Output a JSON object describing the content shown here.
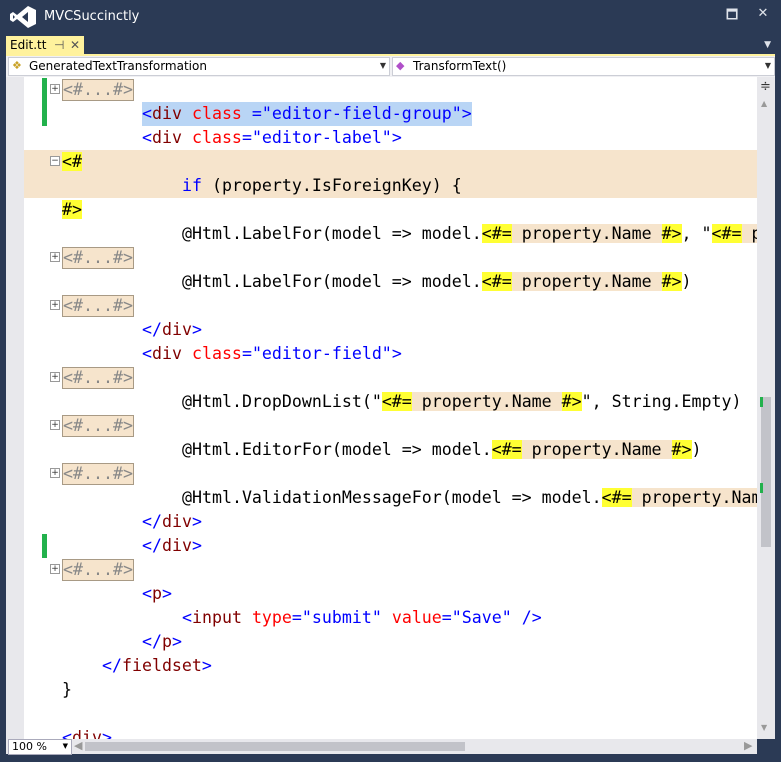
{
  "window": {
    "title": "MVCSuccinctly",
    "maximize_icon": "maximize-icon",
    "close_icon": "close-icon"
  },
  "tab": {
    "label": "Edit.tt",
    "pin_glyph": "⊣",
    "close_glyph": "✕"
  },
  "navbar": {
    "type_combo": "GeneratedTextTransformation",
    "member_combo": "TransformText()"
  },
  "zoom": {
    "value": "100 %"
  },
  "colors": {
    "frame": "#2b3a55",
    "tab": "#fff29d",
    "t4_tag": "#ffff33",
    "t4_block": "#f6e4cc",
    "selection": "#b9d5f5",
    "change_marker": "#22b14c"
  },
  "lines": [
    {
      "indent": 0,
      "toggle": "+",
      "marker": true,
      "segs": [
        [
          "box",
          "<#...#>"
        ]
      ]
    },
    {
      "indent": 8,
      "marker": true,
      "sel": true,
      "segs": [
        [
          "d",
          "<"
        ],
        [
          "e",
          "div"
        ],
        [
          "a",
          " class"
        ],
        [
          "d",
          " ="
        ],
        [
          "v",
          "\"editor-field-group\""
        ],
        [
          "d",
          ">"
        ]
      ]
    },
    {
      "indent": 8,
      "segs": [
        [
          "d",
          "<"
        ],
        [
          "e",
          "div"
        ],
        [
          "a",
          " class"
        ],
        [
          "d",
          "="
        ],
        [
          "v",
          "\"editor-label\""
        ],
        [
          "d",
          ">"
        ]
      ]
    },
    {
      "indent": 0,
      "toggle": "−",
      "bg": "tan",
      "segs": [
        [
          "y",
          "<#"
        ]
      ]
    },
    {
      "indent": 12,
      "bg": "tan",
      "segs": [
        [
          "k",
          "if"
        ],
        [
          "t",
          " (property.IsForeignKey) {"
        ]
      ]
    },
    {
      "indent": 0,
      "segs": [
        [
          "y",
          "#>"
        ]
      ]
    },
    {
      "indent": 12,
      "segs": [
        [
          "t",
          "@Html.LabelFor(model => model."
        ],
        [
          "y",
          "<#="
        ],
        [
          "c",
          " property.Name "
        ],
        [
          "y",
          "#>"
        ],
        [
          "t",
          ", \""
        ],
        [
          "y",
          "<#="
        ],
        [
          "c",
          " property.Name "
        ],
        [
          "y",
          "#>"
        ]
      ]
    },
    {
      "indent": 0,
      "toggle": "+",
      "segs": [
        [
          "box",
          "<#...#>"
        ]
      ]
    },
    {
      "indent": 12,
      "segs": [
        [
          "t",
          "@Html.LabelFor(model => model."
        ],
        [
          "y",
          "<#="
        ],
        [
          "c",
          " property.Name "
        ],
        [
          "y",
          "#>"
        ],
        [
          "t",
          ")"
        ]
      ]
    },
    {
      "indent": 0,
      "toggle": "+",
      "segs": [
        [
          "box",
          "<#...#>"
        ]
      ]
    },
    {
      "indent": 8,
      "segs": [
        [
          "d",
          "</"
        ],
        [
          "e",
          "div"
        ],
        [
          "d",
          ">"
        ]
      ]
    },
    {
      "indent": 8,
      "segs": [
        [
          "d",
          "<"
        ],
        [
          "e",
          "div"
        ],
        [
          "a",
          " class"
        ],
        [
          "d",
          "="
        ],
        [
          "v",
          "\"editor-field\""
        ],
        [
          "d",
          ">"
        ]
      ]
    },
    {
      "indent": 0,
      "toggle": "+",
      "segs": [
        [
          "box",
          "<#...#>"
        ]
      ]
    },
    {
      "indent": 12,
      "segs": [
        [
          "t",
          "@Html.DropDownList(\""
        ],
        [
          "y",
          "<#="
        ],
        [
          "c",
          " property.Name "
        ],
        [
          "y",
          "#>"
        ],
        [
          "t",
          "\", String.Empty)"
        ]
      ]
    },
    {
      "indent": 0,
      "toggle": "+",
      "segs": [
        [
          "box",
          "<#...#>"
        ]
      ]
    },
    {
      "indent": 12,
      "segs": [
        [
          "t",
          "@Html.EditorFor(model => model."
        ],
        [
          "y",
          "<#="
        ],
        [
          "c",
          " property.Name "
        ],
        [
          "y",
          "#>"
        ],
        [
          "t",
          ")"
        ]
      ]
    },
    {
      "indent": 0,
      "toggle": "+",
      "segs": [
        [
          "box",
          "<#...#>"
        ]
      ]
    },
    {
      "indent": 12,
      "segs": [
        [
          "t",
          "@Html.ValidationMessageFor(model => model."
        ],
        [
          "y",
          "<#="
        ],
        [
          "c",
          " property.Name "
        ],
        [
          "y",
          "#>"
        ]
      ]
    },
    {
      "indent": 8,
      "segs": [
        [
          "d",
          "</"
        ],
        [
          "e",
          "div"
        ],
        [
          "d",
          ">"
        ]
      ]
    },
    {
      "indent": 8,
      "marker": true,
      "segs": [
        [
          "d",
          "</"
        ],
        [
          "e",
          "div"
        ],
        [
          "d",
          ">"
        ]
      ]
    },
    {
      "indent": 0,
      "toggle": "+",
      "segs": [
        [
          "box",
          "<#...#>"
        ]
      ]
    },
    {
      "indent": 8,
      "segs": [
        [
          "d",
          "<"
        ],
        [
          "e",
          "p"
        ],
        [
          "d",
          ">"
        ]
      ]
    },
    {
      "indent": 12,
      "segs": [
        [
          "d",
          "<"
        ],
        [
          "e",
          "input"
        ],
        [
          "a",
          " type"
        ],
        [
          "d",
          "="
        ],
        [
          "v",
          "\"submit\""
        ],
        [
          "a",
          " value"
        ],
        [
          "d",
          "="
        ],
        [
          "v",
          "\"Save\""
        ],
        [
          "d",
          " />"
        ]
      ]
    },
    {
      "indent": 8,
      "segs": [
        [
          "d",
          "</"
        ],
        [
          "e",
          "p"
        ],
        [
          "d",
          ">"
        ]
      ]
    },
    {
      "indent": 4,
      "segs": [
        [
          "d",
          "</"
        ],
        [
          "e",
          "fieldset"
        ],
        [
          "d",
          ">"
        ]
      ]
    },
    {
      "indent": 0,
      "segs": [
        [
          "t",
          "}"
        ]
      ]
    },
    {
      "indent": 0,
      "segs": []
    },
    {
      "indent": 0,
      "segs": [
        [
          "d",
          "<"
        ],
        [
          "e",
          "div"
        ],
        [
          "d",
          ">"
        ]
      ]
    }
  ]
}
